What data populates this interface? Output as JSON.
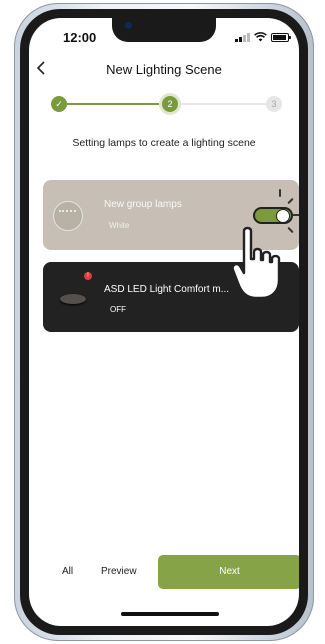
{
  "status_bar": {
    "time": "12:00",
    "icons": [
      "signal-icon",
      "wifi-icon",
      "battery-icon"
    ]
  },
  "header": {
    "back_icon": "chevron-left-icon",
    "title": "New Lighting Scene"
  },
  "stepper": {
    "steps": [
      {
        "label": "✓",
        "state": "done"
      },
      {
        "label": "2",
        "state": "current"
      },
      {
        "label": "3",
        "state": "upcoming"
      }
    ],
    "accent_color": "#7a9a3d"
  },
  "subtitle": "Setting lamps to create a lighting scene",
  "cards": [
    {
      "name": "New group lamps",
      "status": "White",
      "icon": "lamp-group-icon",
      "toggle_on": true,
      "background": "#c7bfb5"
    },
    {
      "name": "ASD LED Light Comfort m...",
      "status": "OFF",
      "icon": "ceiling-light-icon",
      "badge": "!",
      "background": "#222222"
    }
  ],
  "annotation_icon": "pointing-hand-icon",
  "bottom_bar": {
    "all_label": "All",
    "preview_label": "Preview",
    "next_label": "Next",
    "next_color": "#86a447"
  }
}
